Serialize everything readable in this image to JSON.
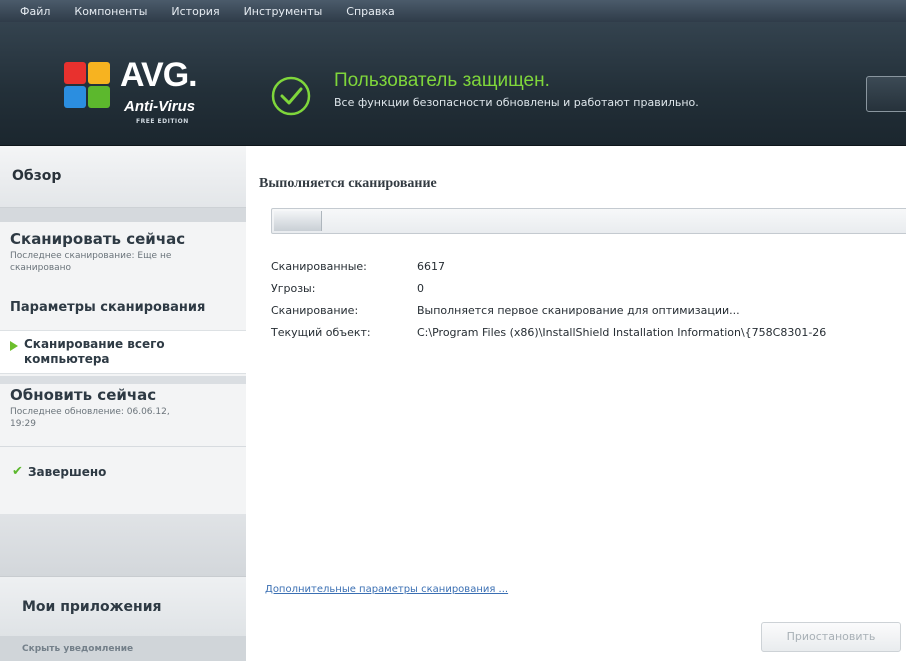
{
  "menubar": {
    "items": [
      "Файл",
      "Компоненты",
      "История",
      "Инструменты",
      "Справка"
    ]
  },
  "logo": {
    "brand": "AVG.",
    "product": "Anti-Virus",
    "edition": "FREE EDITION"
  },
  "status": {
    "title": "Пользователь защищен.",
    "subtitle": "Все функции безопасности обновлены и работают правильно.",
    "icon": "check-circle-icon",
    "color": "#7fd63b"
  },
  "sidebar": {
    "overview": "Обзор",
    "scan_now": "Сканировать сейчас",
    "scan_last": "Последнее сканирование: Еще не сканировано",
    "scan_params": "Параметры сканирования",
    "full_scan": "Сканирование всего компьютера",
    "update_now": "Обновить сейчас",
    "update_last": "Последнее обновление: 06.06.12, 19:29",
    "finished": "Завершено",
    "my_apps": "Мои приложения",
    "hide_notification": "Скрыть уведомление"
  },
  "main": {
    "title": "Выполняется сканирование",
    "progress": 0.075,
    "rows": [
      {
        "label": "Сканированные:",
        "value": "6617"
      },
      {
        "label": "Угрозы:",
        "value": "0"
      },
      {
        "label": "Сканирование:",
        "value": "Выполняется первое сканирование для оптимизации..."
      },
      {
        "label": "Текущий объект:",
        "value": "C:\\Program Files (x86)\\InstallShield Installation Information\\{758C8301-26"
      }
    ],
    "advanced_link": "Дополнительные параметры сканирования ...",
    "pause_button": "Приостановить"
  }
}
